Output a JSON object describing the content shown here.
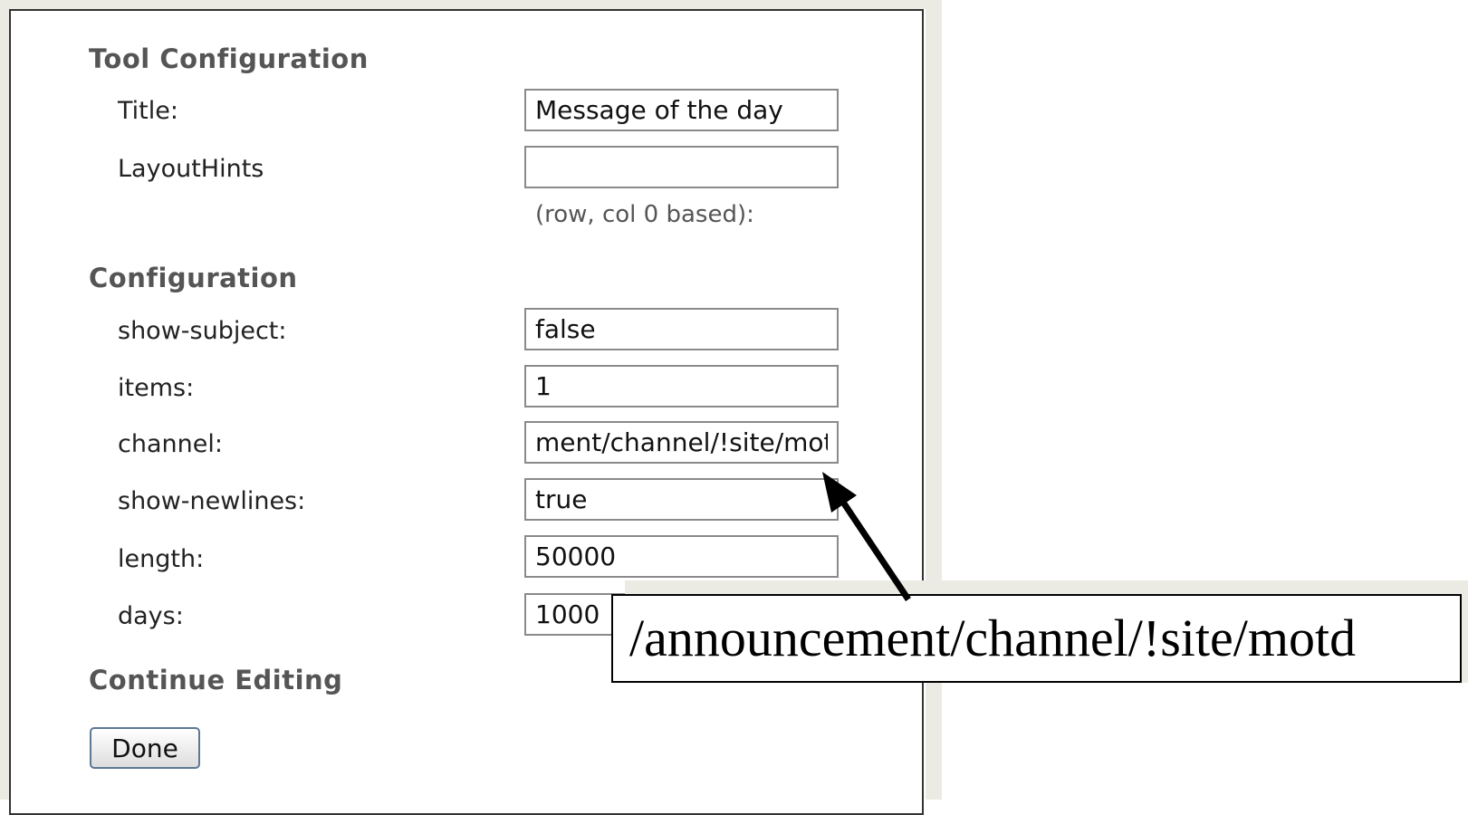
{
  "tool_configuration": {
    "heading": "Tool Configuration",
    "title_label": "Title:",
    "title_value": "Message of the day",
    "layout_label": "LayoutHints",
    "layout_value": "",
    "layout_hint": "(row, col 0 based):"
  },
  "configuration": {
    "heading": "Configuration",
    "fields": [
      {
        "label": "show-subject:",
        "value": "false"
      },
      {
        "label": "items:",
        "value": "1"
      },
      {
        "label": "channel:",
        "value": "ment/channel/!site/motd"
      },
      {
        "label": "show-newlines:",
        "value": "true"
      },
      {
        "label": "length:",
        "value": "50000"
      },
      {
        "label": "days:",
        "value": "1000"
      }
    ]
  },
  "continue_editing": {
    "heading": "Continue Editing",
    "done_label": "Done"
  },
  "callout": {
    "text": "/announcement/channel/!site/motd"
  }
}
